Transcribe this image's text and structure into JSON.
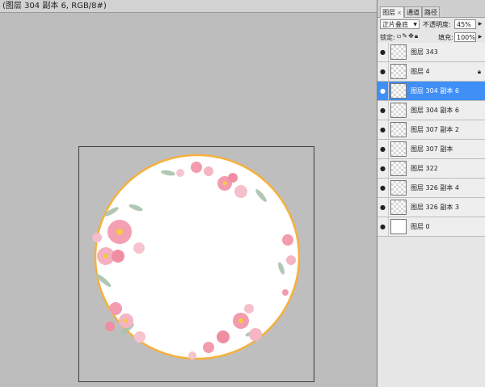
{
  "document": {
    "title": "(图层 304 副本 6, RGB/8#)"
  },
  "panel": {
    "tabs": [
      {
        "label": "图层",
        "close": "×"
      },
      {
        "label": "通道"
      },
      {
        "label": "路径"
      }
    ],
    "blend_mode": "正片叠底",
    "opacity_label": "不透明度:",
    "opacity_value": "45%",
    "lock_label": "锁定:",
    "fill_label": "填充:",
    "fill_value": "100%",
    "layers": [
      {
        "name": "图层 343",
        "selected": false,
        "locked": false,
        "thumb": "transparent"
      },
      {
        "name": "图层 4",
        "selected": false,
        "locked": true,
        "thumb": "transparent"
      },
      {
        "name": "图层 304 副本 6",
        "selected": true,
        "locked": false,
        "thumb": "transparent"
      },
      {
        "name": "图层 304 副本 6",
        "selected": false,
        "locked": false,
        "thumb": "transparent"
      },
      {
        "name": "图层 307 副本 2",
        "selected": false,
        "locked": false,
        "thumb": "transparent"
      },
      {
        "name": "图层 307 副本",
        "selected": false,
        "locked": false,
        "thumb": "transparent"
      },
      {
        "name": "图层 322",
        "selected": false,
        "locked": false,
        "thumb": "transparent"
      },
      {
        "name": "图层 326 副本 4",
        "selected": false,
        "locked": false,
        "thumb": "transparent"
      },
      {
        "name": "图层 326 副本 3",
        "selected": false,
        "locked": false,
        "thumb": "transparent"
      },
      {
        "name": "图层 0",
        "selected": false,
        "locked": false,
        "thumb": "white"
      }
    ]
  },
  "colors": {
    "selection": "#3f8ff7",
    "ring": "#f5b13c",
    "flower": "#f29cae",
    "leaf": "#9fb8a4"
  }
}
